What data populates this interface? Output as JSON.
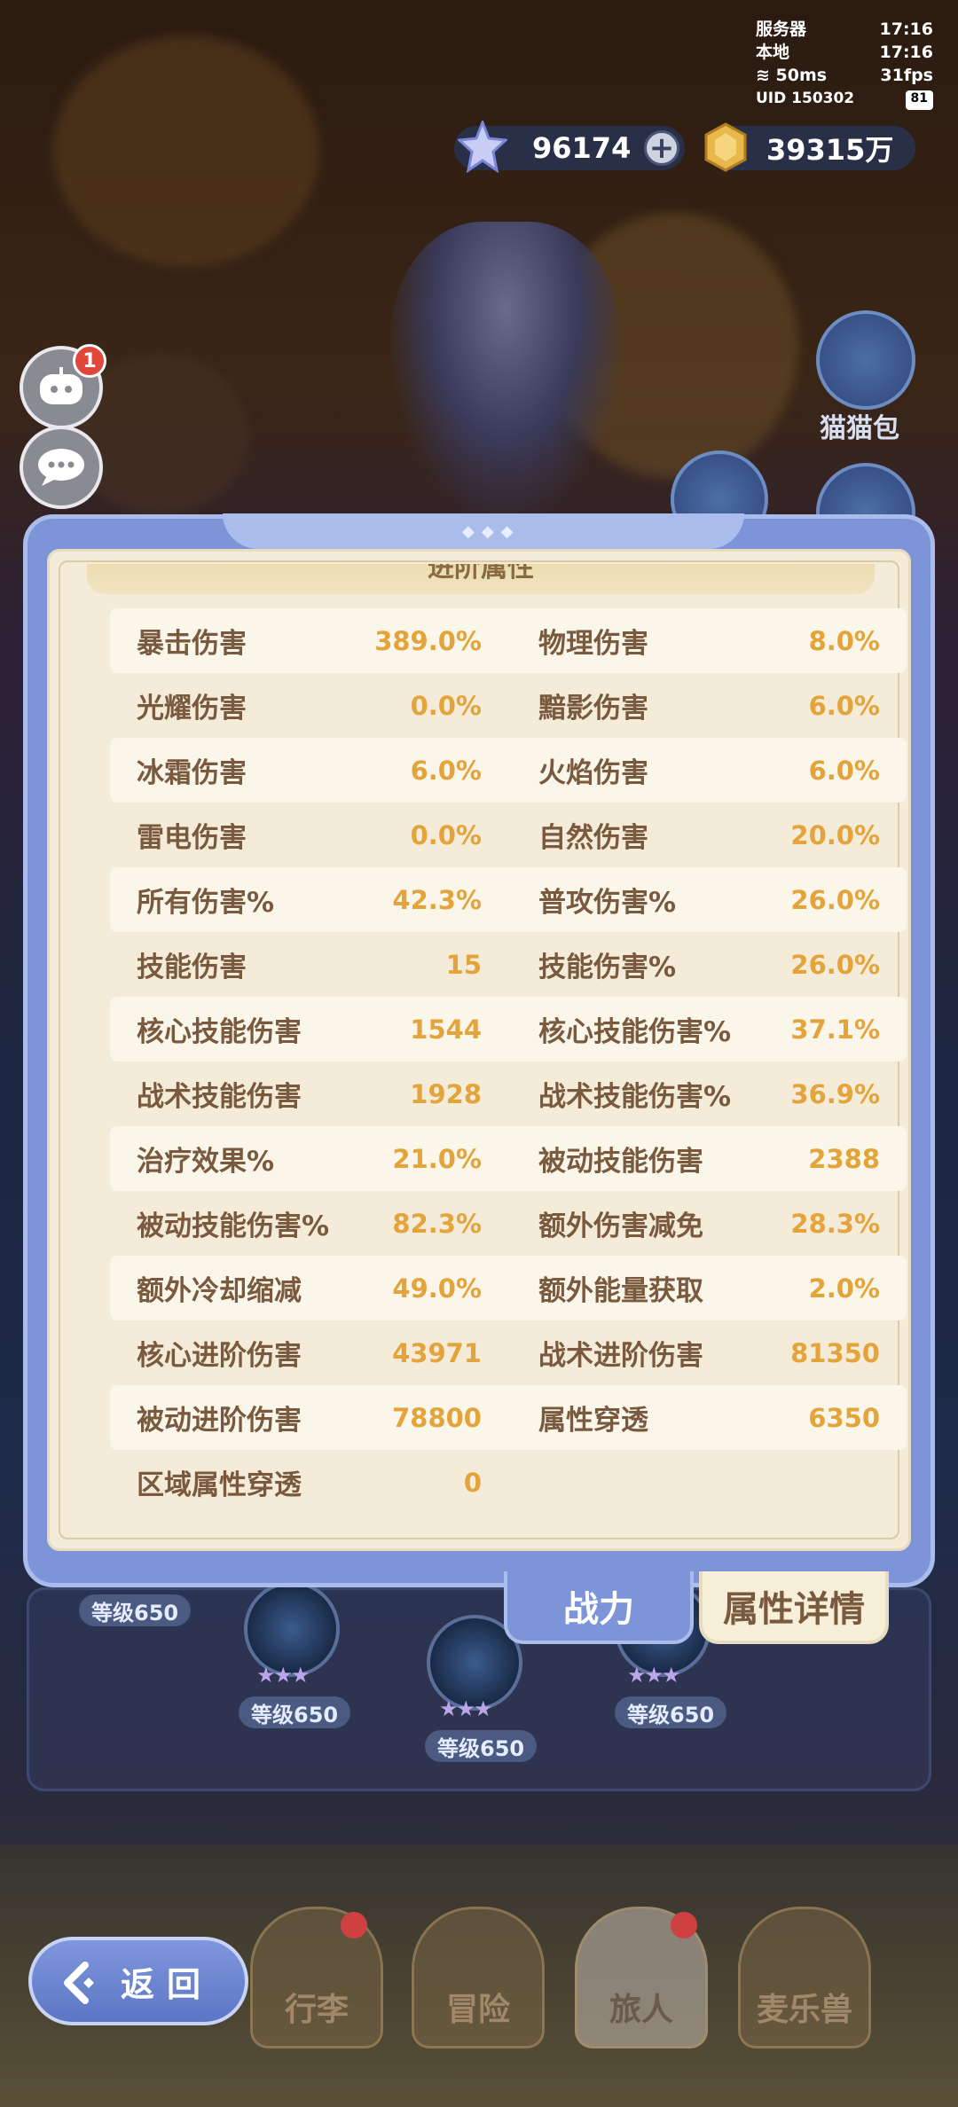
{
  "hud": {
    "server_label": "服务器",
    "server_time": "17:16",
    "local_label": "本地",
    "local_time": "17:16",
    "ping": "50ms",
    "fps": "31fps",
    "uid": "UID 150302",
    "battery": "81"
  },
  "currency": {
    "gems": "96174",
    "coins": "39315万"
  },
  "side": {
    "badge_count": "1"
  },
  "right_icons": {
    "cat_bag_label": "猫猫包"
  },
  "panel": {
    "section_title": "进阶属性",
    "stats": [
      [
        {
          "label": "暴击伤害",
          "value": "389.0%"
        },
        {
          "label": "物理伤害",
          "value": "8.0%"
        }
      ],
      [
        {
          "label": "光耀伤害",
          "value": "0.0%"
        },
        {
          "label": "黯影伤害",
          "value": "6.0%"
        }
      ],
      [
        {
          "label": "冰霜伤害",
          "value": "6.0%"
        },
        {
          "label": "火焰伤害",
          "value": "6.0%"
        }
      ],
      [
        {
          "label": "雷电伤害",
          "value": "0.0%"
        },
        {
          "label": "自然伤害",
          "value": "20.0%"
        }
      ],
      [
        {
          "label": "所有伤害%",
          "value": "42.3%"
        },
        {
          "label": "普攻伤害%",
          "value": "26.0%"
        }
      ],
      [
        {
          "label": "技能伤害",
          "value": "15"
        },
        {
          "label": "技能伤害%",
          "value": "26.0%"
        }
      ],
      [
        {
          "label": "核心技能伤害",
          "value": "1544"
        },
        {
          "label": "核心技能伤害%",
          "value": "37.1%"
        }
      ],
      [
        {
          "label": "战术技能伤害",
          "value": "1928"
        },
        {
          "label": "战术技能伤害%",
          "value": "36.9%"
        }
      ],
      [
        {
          "label": "治疗效果%",
          "value": "21.0%"
        },
        {
          "label": "被动技能伤害",
          "value": "2388"
        }
      ],
      [
        {
          "label": "被动技能伤害%",
          "value": "82.3%"
        },
        {
          "label": "额外伤害减免",
          "value": "28.3%"
        }
      ],
      [
        {
          "label": "额外冷却缩减",
          "value": "49.0%"
        },
        {
          "label": "额外能量获取",
          "value": "2.0%"
        }
      ],
      [
        {
          "label": "核心进阶伤害",
          "value": "43971"
        },
        {
          "label": "战术进阶伤害",
          "value": "81350"
        }
      ],
      [
        {
          "label": "被动进阶伤害",
          "value": "78800"
        },
        {
          "label": "属性穿透",
          "value": "6350"
        }
      ],
      [
        {
          "label": "区域属性穿透",
          "value": "0"
        },
        {
          "label": "",
          "value": ""
        }
      ]
    ]
  },
  "tabs": {
    "power": "战力",
    "detail": "属性详情"
  },
  "tree": {
    "level_label": "等级650"
  },
  "nav": {
    "items": [
      "行李",
      "冒险",
      "旅人",
      "麦乐兽"
    ],
    "back": "返回"
  }
}
